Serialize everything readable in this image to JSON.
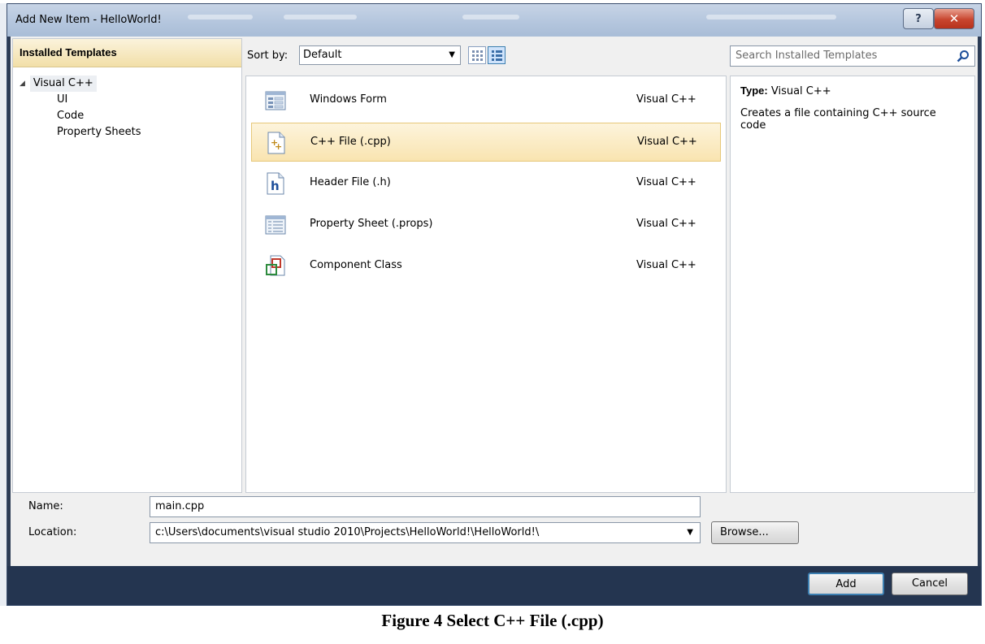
{
  "window": {
    "title": "Add New Item - HelloWorld!"
  },
  "left_pane": {
    "header": "Installed Templates",
    "tree": [
      {
        "label": "Visual C++",
        "expanded": true,
        "children": [
          "UI",
          "Code",
          "Property Sheets"
        ]
      }
    ]
  },
  "toolbar": {
    "sort_label": "Sort by:",
    "sort_value": "Default"
  },
  "templates": [
    {
      "name": "Windows Form",
      "lang": "Visual C++",
      "icon": "windows-form-icon",
      "selected": false
    },
    {
      "name": "C++ File (.cpp)",
      "lang": "Visual C++",
      "icon": "cpp-file-icon",
      "selected": true
    },
    {
      "name": "Header File (.h)",
      "lang": "Visual C++",
      "icon": "header-file-icon",
      "selected": false
    },
    {
      "name": "Property Sheet (.props)",
      "lang": "Visual C++",
      "icon": "property-sheet-icon",
      "selected": false
    },
    {
      "name": "Component Class",
      "lang": "Visual C++",
      "icon": "component-class-icon",
      "selected": false
    }
  ],
  "search": {
    "placeholder": "Search Installed Templates"
  },
  "details": {
    "type_label": "Type:",
    "type_value": "Visual C++",
    "description": "Creates a file containing C++ source code"
  },
  "form": {
    "name_label": "Name:",
    "name_value": "main.cpp",
    "location_label": "Location:",
    "location_value": "c:\\Users\\documents\\visual studio 2010\\Projects\\HelloWorld!\\HelloWorld!\\",
    "browse_label": "Browse..."
  },
  "buttons": {
    "add": "Add",
    "cancel": "Cancel"
  },
  "caption": "Figure 4  Select C++ File (.cpp)",
  "colors": {
    "selection": "#f9e4b0",
    "footer": "#243550",
    "header": "#f2dfa8"
  }
}
